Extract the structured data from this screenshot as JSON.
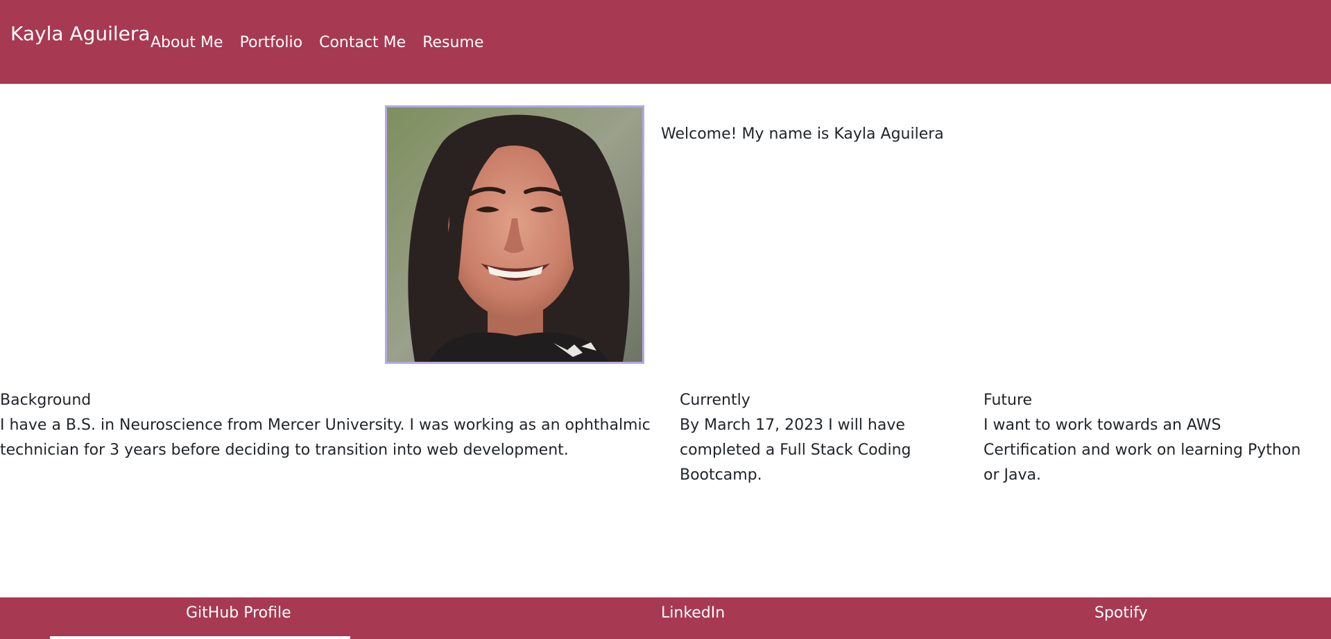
{
  "header": {
    "brand": "Kayla Aguilera",
    "nav": [
      {
        "label": "About Me"
      },
      {
        "label": "Portfolio"
      },
      {
        "label": "Contact Me"
      },
      {
        "label": "Resume"
      }
    ]
  },
  "hero": {
    "welcome_text": "Welcome! My name is Kayla Aguilera",
    "photo_alt": "Kayla Aguilera profile photo"
  },
  "sections": [
    {
      "title": "Background",
      "body": "I have a B.S. in Neuroscience from Mercer University. I was working as an ophthalmic technician for 3 years before deciding to transition into web development."
    },
    {
      "title": "Currently",
      "body": "By March 17, 2023 I will have completed a Full Stack Coding Bootcamp."
    },
    {
      "title": "Future",
      "body": "I want to work towards an AWS Certification and work on learning Python or Java."
    }
  ],
  "footer": {
    "links": [
      {
        "label": "GitHub Profile"
      },
      {
        "label": "LinkedIn"
      },
      {
        "label": "Spotify"
      }
    ]
  },
  "colors": {
    "brand": "#a83952",
    "photo_border": "#b2a8e6",
    "text": "#212529"
  }
}
